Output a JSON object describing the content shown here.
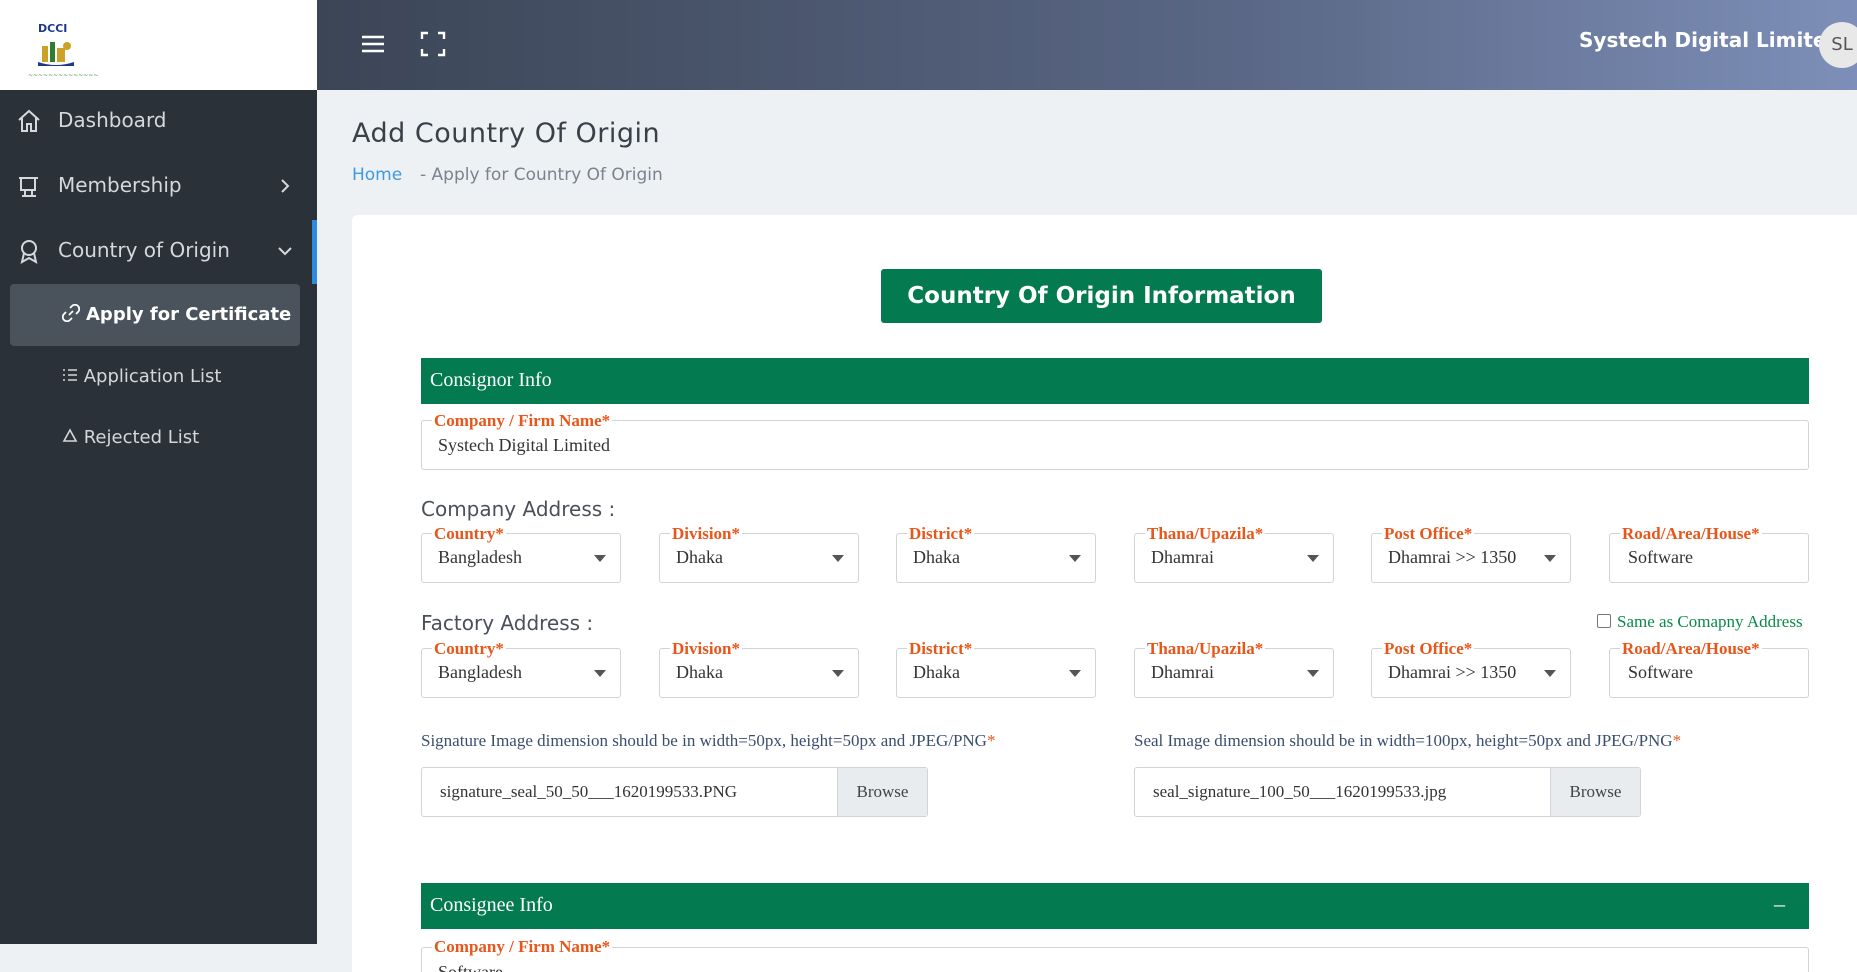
{
  "brand": {
    "logo_text": "DCCI"
  },
  "sidebar": {
    "items": [
      {
        "label": "Dashboard"
      },
      {
        "label": "Membership"
      },
      {
        "label": "Country of Origin"
      }
    ],
    "sub_items": [
      {
        "label": "Apply for Certificate",
        "active": true
      },
      {
        "label": "Application List"
      },
      {
        "label": "Rejected List"
      }
    ]
  },
  "topbar": {
    "user_name": "Systech Digital Limited",
    "avatar_initials": "SL"
  },
  "page": {
    "title": "Add Country Of Origin",
    "breadcrumb": {
      "home": "Home",
      "current": "-  Apply for Country Of Origin"
    }
  },
  "form": {
    "main_button": "Country Of Origin Information",
    "consignor": {
      "section_title": "Consignor Info",
      "company_name_label": "Company / Firm Name",
      "company_name_value": "Systech Digital Limited",
      "company_address_label": "Company Address :",
      "factory_address_label": "Factory Address :",
      "same_as_label": "Same as Comapny Address",
      "address_fields": [
        {
          "label": "Country",
          "value": "Bangladesh"
        },
        {
          "label": "Division",
          "value": "Dhaka"
        },
        {
          "label": "District",
          "value": "Dhaka"
        },
        {
          "label": "Thana/Upazila",
          "value": "Dhamrai"
        },
        {
          "label": "Post Office",
          "value": "Dhamrai >> 1350"
        },
        {
          "label": "Road/Area/House",
          "value": "Software"
        }
      ],
      "factory_fields": [
        {
          "label": "Country",
          "value": "Bangladesh"
        },
        {
          "label": "Division",
          "value": "Dhaka"
        },
        {
          "label": "District",
          "value": "Dhaka"
        },
        {
          "label": "Thana/Upazila",
          "value": "Dhamrai"
        },
        {
          "label": "Post Office",
          "value": "Dhamrai >> 1350"
        },
        {
          "label": "Road/Area/House",
          "value": "Software"
        }
      ],
      "signature_hint": "Signature Image dimension should be in width=50px, height=50px and JPEG/PNG",
      "signature_file": "signature_seal_50_50___1620199533.PNG",
      "seal_hint": "Seal Image dimension should be in width=100px, height=50px and JPEG/PNG",
      "seal_file": "seal_signature_100_50___1620199533.jpg",
      "browse_label": "Browse",
      "required_mark": "*"
    },
    "consignee": {
      "section_title": "Consignee Info",
      "collapse_symbol": "–",
      "company_name_label": "Company / Firm Name",
      "company_name_value": "Software"
    }
  },
  "colors": {
    "primary_green": "#047a50",
    "sidebar_bg": "#2a3138",
    "label_orange": "#e8561a",
    "link_blue": "#3c9ae0"
  }
}
